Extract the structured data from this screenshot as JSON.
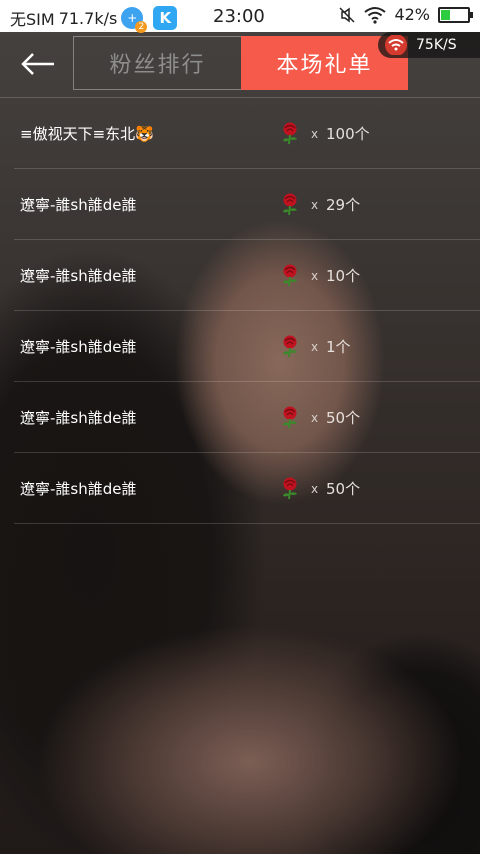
{
  "status_bar": {
    "carrier": "无SIM",
    "speed": "71.7k/s",
    "notif_badge": "2",
    "app_icon_letter": "K",
    "time": "23:00",
    "battery": "42%",
    "battery_level": 0.42
  },
  "network_badge": {
    "speed": "75K/S"
  },
  "tabs": [
    {
      "label": "粉丝排行",
      "active": false
    },
    {
      "label": "本场礼单",
      "active": true
    }
  ],
  "gift_list": [
    {
      "user": "≡傲视天下≡东北🐯",
      "times": "x",
      "count": "100个"
    },
    {
      "user": "遼寧-誰sh誰de誰",
      "times": "x",
      "count": "29个"
    },
    {
      "user": "遼寧-誰sh誰de誰",
      "times": "x",
      "count": "10个"
    },
    {
      "user": "遼寧-誰sh誰de誰",
      "times": "x",
      "count": "1个"
    },
    {
      "user": "遼寧-誰sh誰de誰",
      "times": "x",
      "count": "50个"
    },
    {
      "user": "遼寧-誰sh誰de誰",
      "times": "x",
      "count": "50个"
    }
  ],
  "colors": {
    "active_tab": "#f55a4a",
    "inactive_tab_text": "#8d8d8d"
  },
  "icons": {
    "back": "arrow-left-icon",
    "gift": "rose-icon",
    "wifi": "wifi-icon",
    "mute": "mute-icon"
  }
}
